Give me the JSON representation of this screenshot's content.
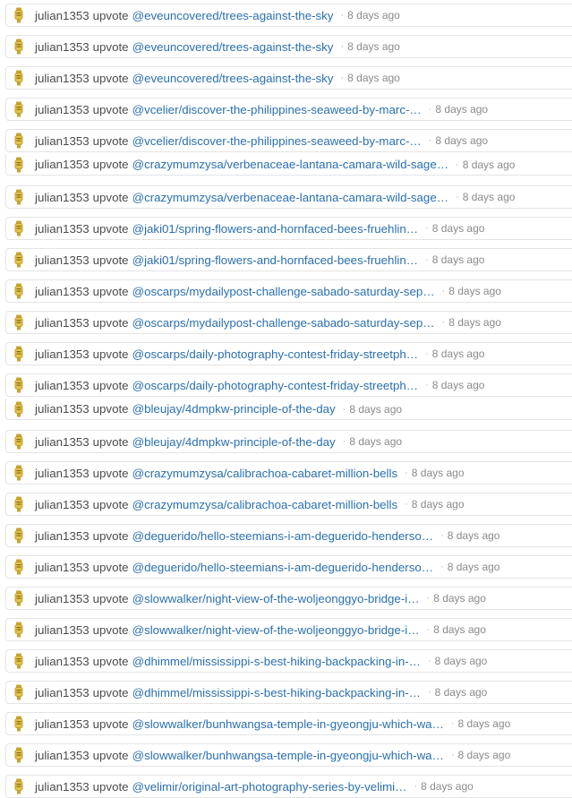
{
  "feed": {
    "items": [
      {
        "user": "julian1353",
        "action": "upvote",
        "link": "@eveuncovered/trees-against-the-sky",
        "time": "8 days ago"
      },
      {
        "user": "julian1353",
        "action": "upvote",
        "link": "@eveuncovered/trees-against-the-sky",
        "time": "8 days ago"
      },
      {
        "user": "julian1353",
        "action": "upvote",
        "link": "@eveuncovered/trees-against-the-sky",
        "time": "8 days ago"
      },
      {
        "user": "julian1353",
        "action": "upvote",
        "link": "@vcelier/discover-the-philippines-seaweed-by-marc-…",
        "time": "8 days ago"
      },
      {
        "user": "julian1353",
        "action": "upvote",
        "link": "@vcelier/discover-the-philippines-seaweed-by-marc-…",
        "time": "8 days ago"
      },
      {
        "user": "julian1353",
        "action": "upvote",
        "link": "@crazymumzysa/verbenaceae-lantana-camara-wild-sage…",
        "time": "8 days ago"
      },
      {
        "user": "julian1353",
        "action": "upvote",
        "link": "@crazymumzysa/verbenaceae-lantana-camara-wild-sage…",
        "time": "8 days ago"
      },
      {
        "user": "julian1353",
        "action": "upvote",
        "link": "@jaki01/spring-flowers-and-hornfaced-bees-fruehlin…",
        "time": "8 days ago"
      },
      {
        "user": "julian1353",
        "action": "upvote",
        "link": "@jaki01/spring-flowers-and-hornfaced-bees-fruehlin…",
        "time": "8 days ago"
      },
      {
        "user": "julian1353",
        "action": "upvote",
        "link": "@oscarps/mydailypost-challenge-sabado-saturday-sep…",
        "time": "8 days ago"
      },
      {
        "user": "julian1353",
        "action": "upvote",
        "link": "@oscarps/mydailypost-challenge-sabado-saturday-sep…",
        "time": "8 days ago"
      },
      {
        "user": "julian1353",
        "action": "upvote",
        "link": "@oscarps/daily-photography-contest-friday-streetph…",
        "time": "8 days ago"
      },
      {
        "user": "julian1353",
        "action": "upvote",
        "link": "@oscarps/daily-photography-contest-friday-streetph…",
        "time": "8 days ago"
      },
      {
        "user": "julian1353",
        "action": "upvote",
        "link": "@bleujay/4dmpkw-principle-of-the-day",
        "time": "8 days ago"
      },
      {
        "user": "julian1353",
        "action": "upvote",
        "link": "@bleujay/4dmpkw-principle-of-the-day",
        "time": "8 days ago"
      },
      {
        "user": "julian1353",
        "action": "upvote",
        "link": "@crazymumzysa/calibrachoa-cabaret-million-bells",
        "time": "8 days ago"
      },
      {
        "user": "julian1353",
        "action": "upvote",
        "link": "@crazymumzysa/calibrachoa-cabaret-million-bells",
        "time": "8 days ago"
      },
      {
        "user": "julian1353",
        "action": "upvote",
        "link": "@deguerido/hello-steemians-i-am-deguerido-henderso…",
        "time": "8 days ago"
      },
      {
        "user": "julian1353",
        "action": "upvote",
        "link": "@deguerido/hello-steemians-i-am-deguerido-henderso…",
        "time": "8 days ago"
      },
      {
        "user": "julian1353",
        "action": "upvote",
        "link": "@slowwalker/night-view-of-the-woljeonggyo-bridge-i…",
        "time": "8 days ago"
      },
      {
        "user": "julian1353",
        "action": "upvote",
        "link": "@slowwalker/night-view-of-the-woljeonggyo-bridge-i…",
        "time": "8 days ago"
      },
      {
        "user": "julian1353",
        "action": "upvote",
        "link": "@dhimmel/mississippi-s-best-hiking-backpacking-in-…",
        "time": "8 days ago"
      },
      {
        "user": "julian1353",
        "action": "upvote",
        "link": "@dhimmel/mississippi-s-best-hiking-backpacking-in-…",
        "time": "8 days ago"
      },
      {
        "user": "julian1353",
        "action": "upvote",
        "link": "@slowwalker/bunhwangsa-temple-in-gyeongju-which-wa…",
        "time": "8 days ago"
      },
      {
        "user": "julian1353",
        "action": "upvote",
        "link": "@slowwalker/bunhwangsa-temple-in-gyeongju-which-wa…",
        "time": "8 days ago"
      },
      {
        "user": "julian1353",
        "action": "upvote",
        "link": "@velimir/original-art-photography-series-by-velimi…",
        "time": "8 days ago"
      }
    ],
    "separator": "·",
    "colors": {
      "link": "#2a6fb0",
      "text": "#4b4b4b",
      "time": "#8a8a8a",
      "border": "#e4e4e4",
      "icon": "#d8b93a"
    }
  }
}
